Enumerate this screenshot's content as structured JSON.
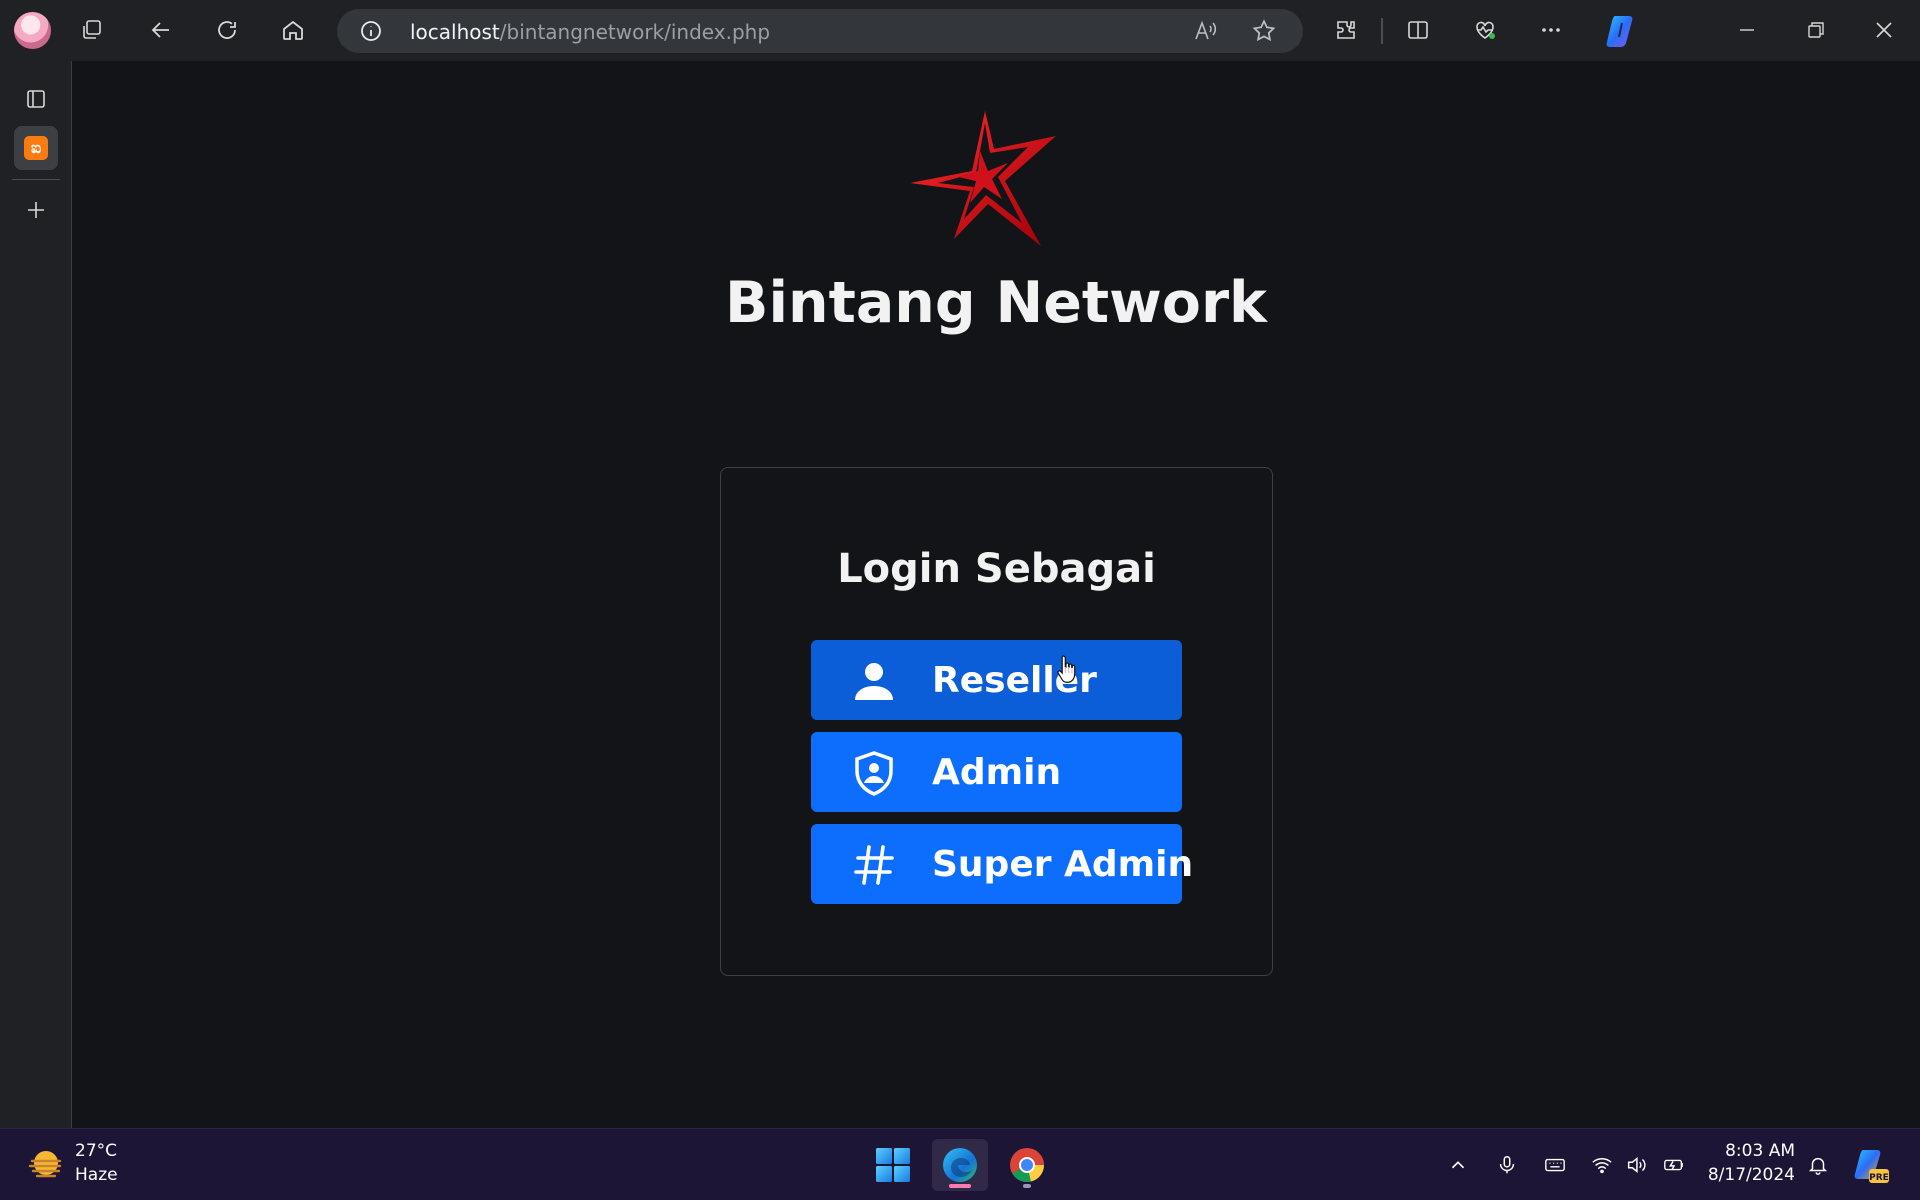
{
  "browser": {
    "url_host": "localhost",
    "url_path": "/bintangnetwork/index.php"
  },
  "page": {
    "brand_title": "Bintang Network",
    "login_heading": "Login Sebagai",
    "roles": [
      {
        "label": "Reseller",
        "icon": "person-icon"
      },
      {
        "label": "Admin",
        "icon": "shield-user-icon"
      },
      {
        "label": "Super Admin",
        "icon": "hash-icon"
      }
    ]
  },
  "taskbar": {
    "temperature": "27°C",
    "condition": "Haze",
    "time": "8:03 AM",
    "date": "8/17/2024"
  },
  "colors": {
    "button_primary": "#0d6efd",
    "button_hover": "#0b5ed7",
    "logo_red": "#d0101a",
    "page_bg": "#121418"
  }
}
